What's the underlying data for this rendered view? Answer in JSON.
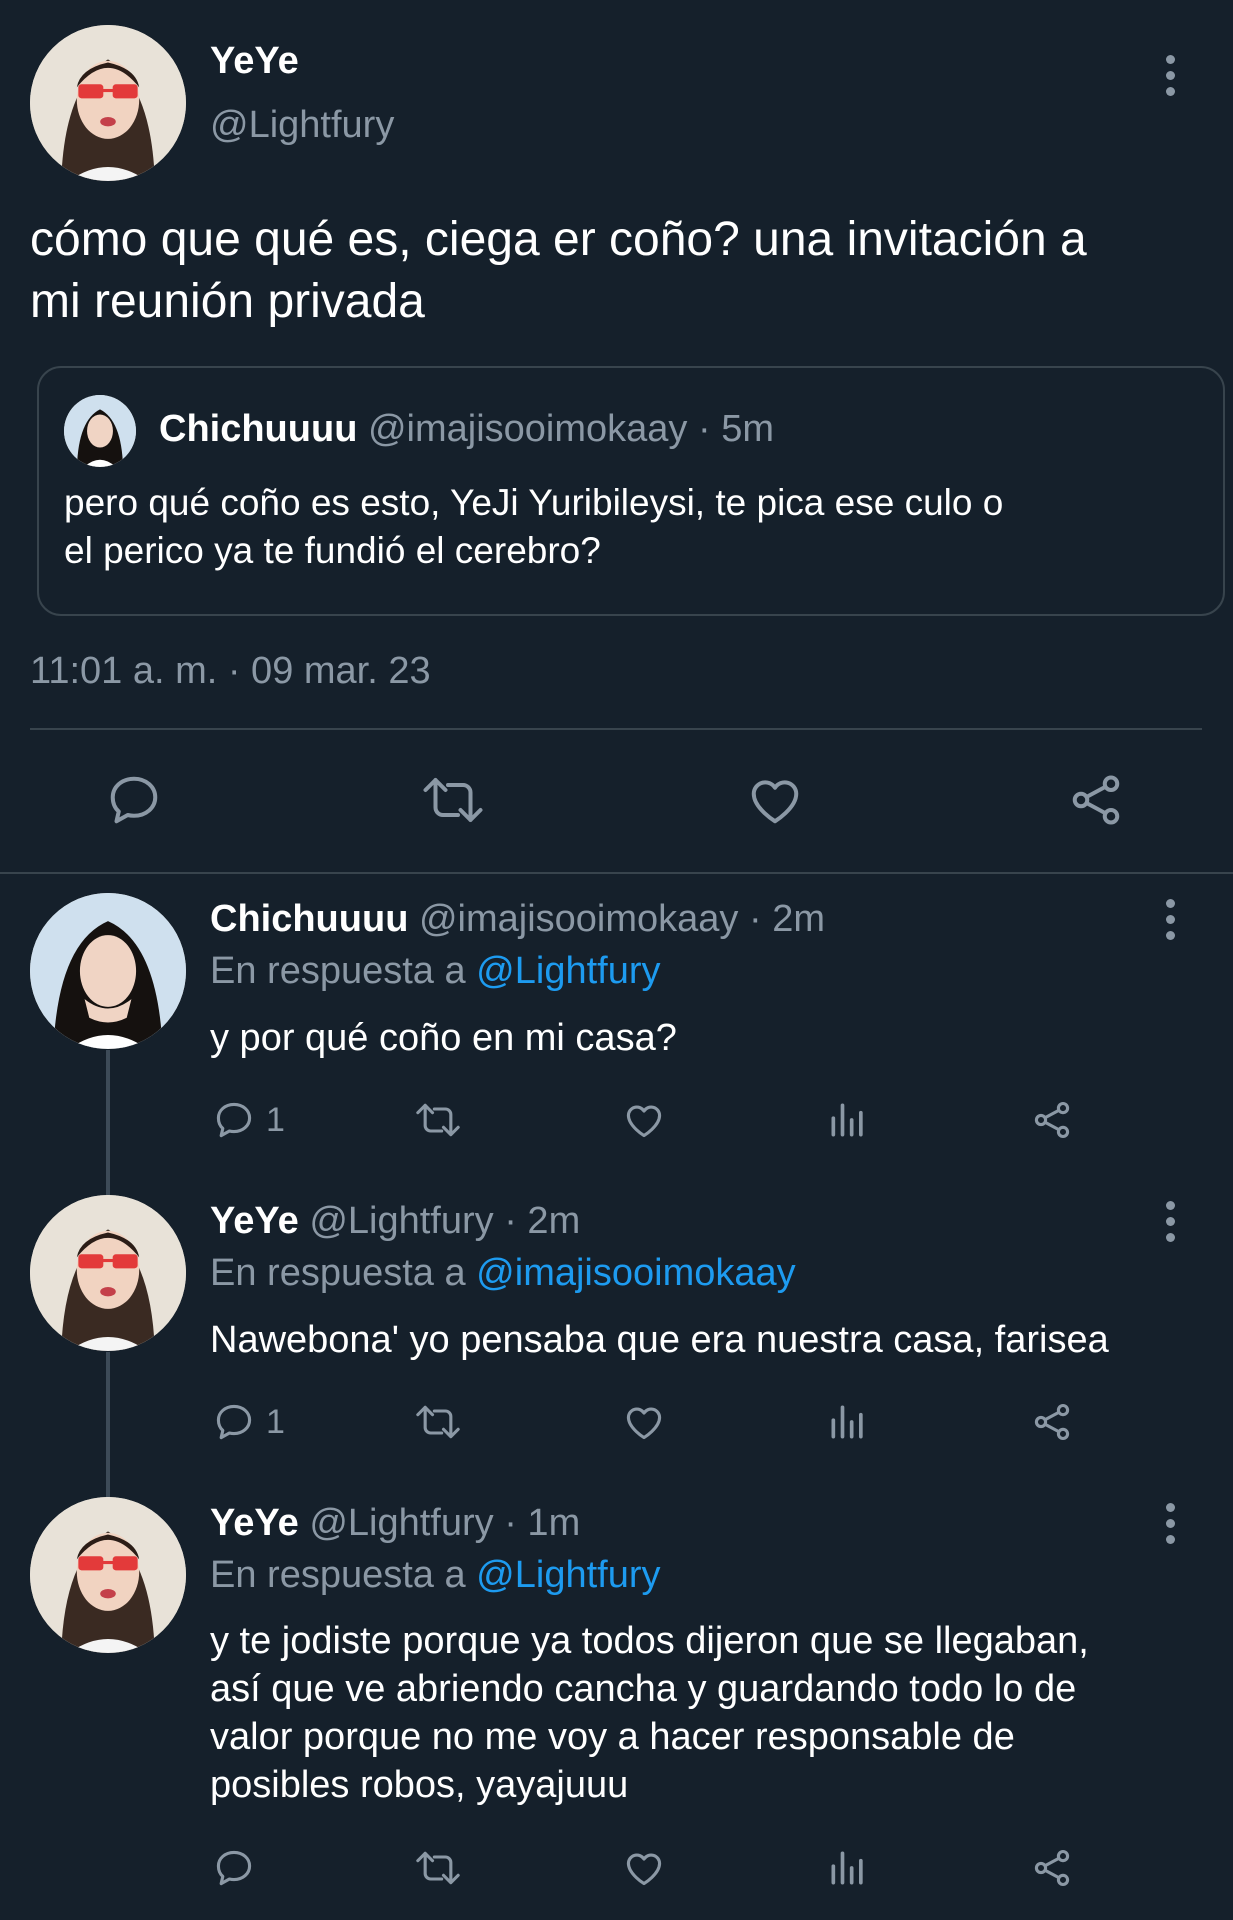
{
  "main_tweet": {
    "display_name": "YeYe",
    "handle": "@Lightfury",
    "text_line1": "cómo que qué es, ciega er coño? una invitación a",
    "text_line2": "mi reunión privada",
    "timestamp": "11:01 a. m. · 09 mar. 23",
    "quoted": {
      "display_name": "Chichuuuu",
      "handle": "@imajisooimokaay",
      "time": "· 5m",
      "text_line1": "pero qué coño es esto, YeJi Yuribileysi, te pica ese culo o",
      "text_line2": "el perico ya te fundió el cerebro?"
    }
  },
  "replies": [
    {
      "display_name": "Chichuuuu",
      "handle": "@imajisooimokaay",
      "time": "· 2m",
      "reply_prefix": "En respuesta a",
      "reply_to": "@Lightfury",
      "text_lines": [
        "y por qué coño en mi casa?"
      ],
      "reply_count": "1"
    },
    {
      "display_name": "YeYe",
      "handle": "@Lightfury",
      "time": "· 2m",
      "reply_prefix": "En respuesta a",
      "reply_to": "@imajisooimokaay",
      "text_lines": [
        "Nawebona' yo pensaba que era nuestra casa, farisea"
      ],
      "reply_count": "1"
    },
    {
      "display_name": "YeYe",
      "handle": "@Lightfury",
      "time": "· 1m",
      "reply_prefix": "En respuesta a",
      "reply_to": "@Lightfury",
      "text_lines": [
        "y te jodiste porque ya todos dijeron que se llegaban,",
        "así que ve abriendo cancha y guardando todo lo de",
        "valor porque no me voy a hacer responsable de",
        "posibles robos, yayajuuu"
      ],
      "reply_count": ""
    }
  ],
  "colors": {
    "background": "#15202b",
    "text": "#ffffff",
    "muted": "#8b98a5",
    "link": "#1d9bf0",
    "divider": "#38444d"
  },
  "icons": [
    "more-icon",
    "reply-icon",
    "retweet-icon",
    "like-icon",
    "views-icon",
    "share-icon"
  ]
}
